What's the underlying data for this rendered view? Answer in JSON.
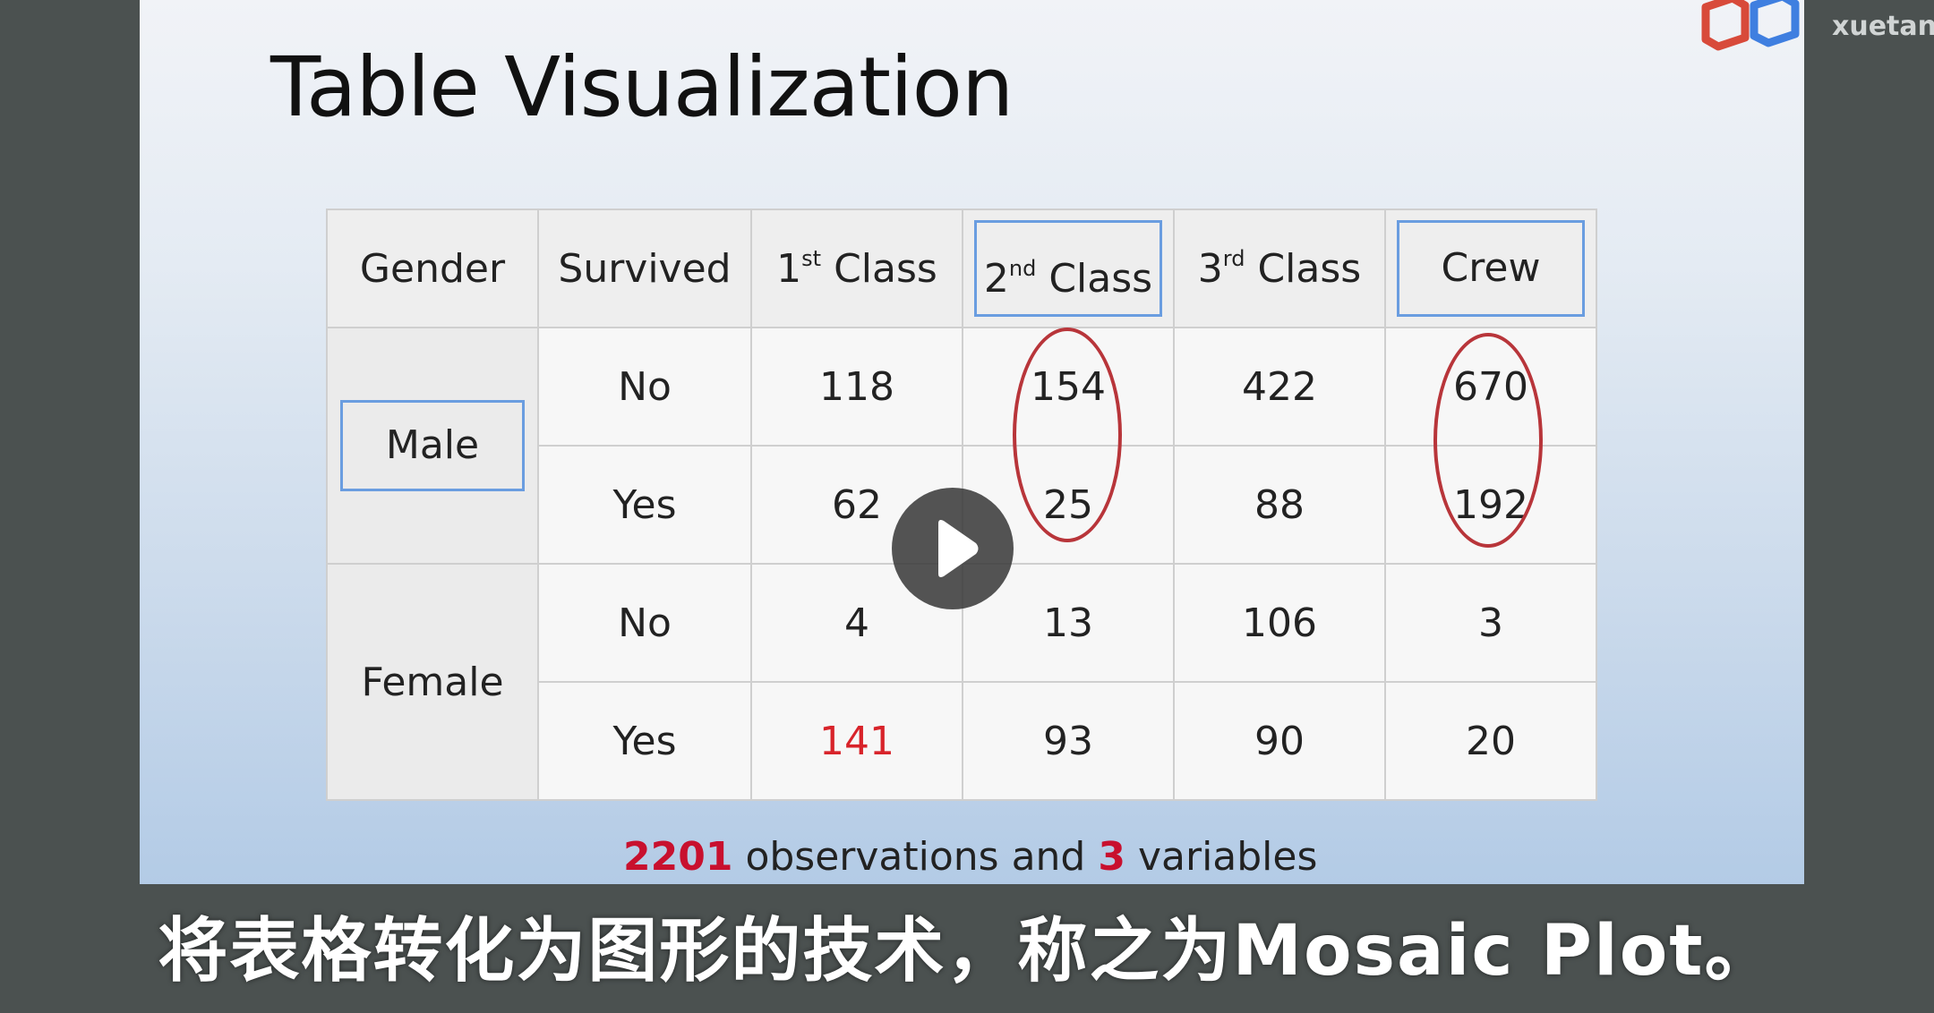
{
  "slide": {
    "title": "Table Visualization"
  },
  "table": {
    "headers": {
      "gender": "Gender",
      "survived": "Survived",
      "class1": {
        "base": "1",
        "sup": "st",
        "rest": " Class"
      },
      "class2": {
        "base": "2",
        "sup": "nd",
        "rest": " Class"
      },
      "class3": {
        "base": "3",
        "sup": "rd",
        "rest": " Class"
      },
      "crew": "Crew"
    },
    "groups": {
      "male": "Male",
      "female": "Female"
    },
    "rows": [
      {
        "survived": "No",
        "c1": "118",
        "c2": "154",
        "c3": "422",
        "crew": "670"
      },
      {
        "survived": "Yes",
        "c1": "62",
        "c2": "25",
        "c3": "88",
        "crew": "192"
      },
      {
        "survived": "No",
        "c1": "4",
        "c2": "13",
        "c3": "106",
        "crew": "3"
      },
      {
        "survived": "Yes",
        "c1": "141",
        "c2": "93",
        "c3": "90",
        "crew": "20"
      }
    ]
  },
  "footnote": {
    "count": "2201",
    "text1": " observations and ",
    "vars": "3",
    "text2": " variables"
  },
  "logo": {
    "text": "xuetan"
  },
  "subtitle": {
    "text": "将表格转化为图形的技术，称之为Mosaic Plot。"
  },
  "colors": {
    "accent_box": "#6a9de0",
    "oval": "#b8353a",
    "highlight_red": "#d8232a"
  }
}
